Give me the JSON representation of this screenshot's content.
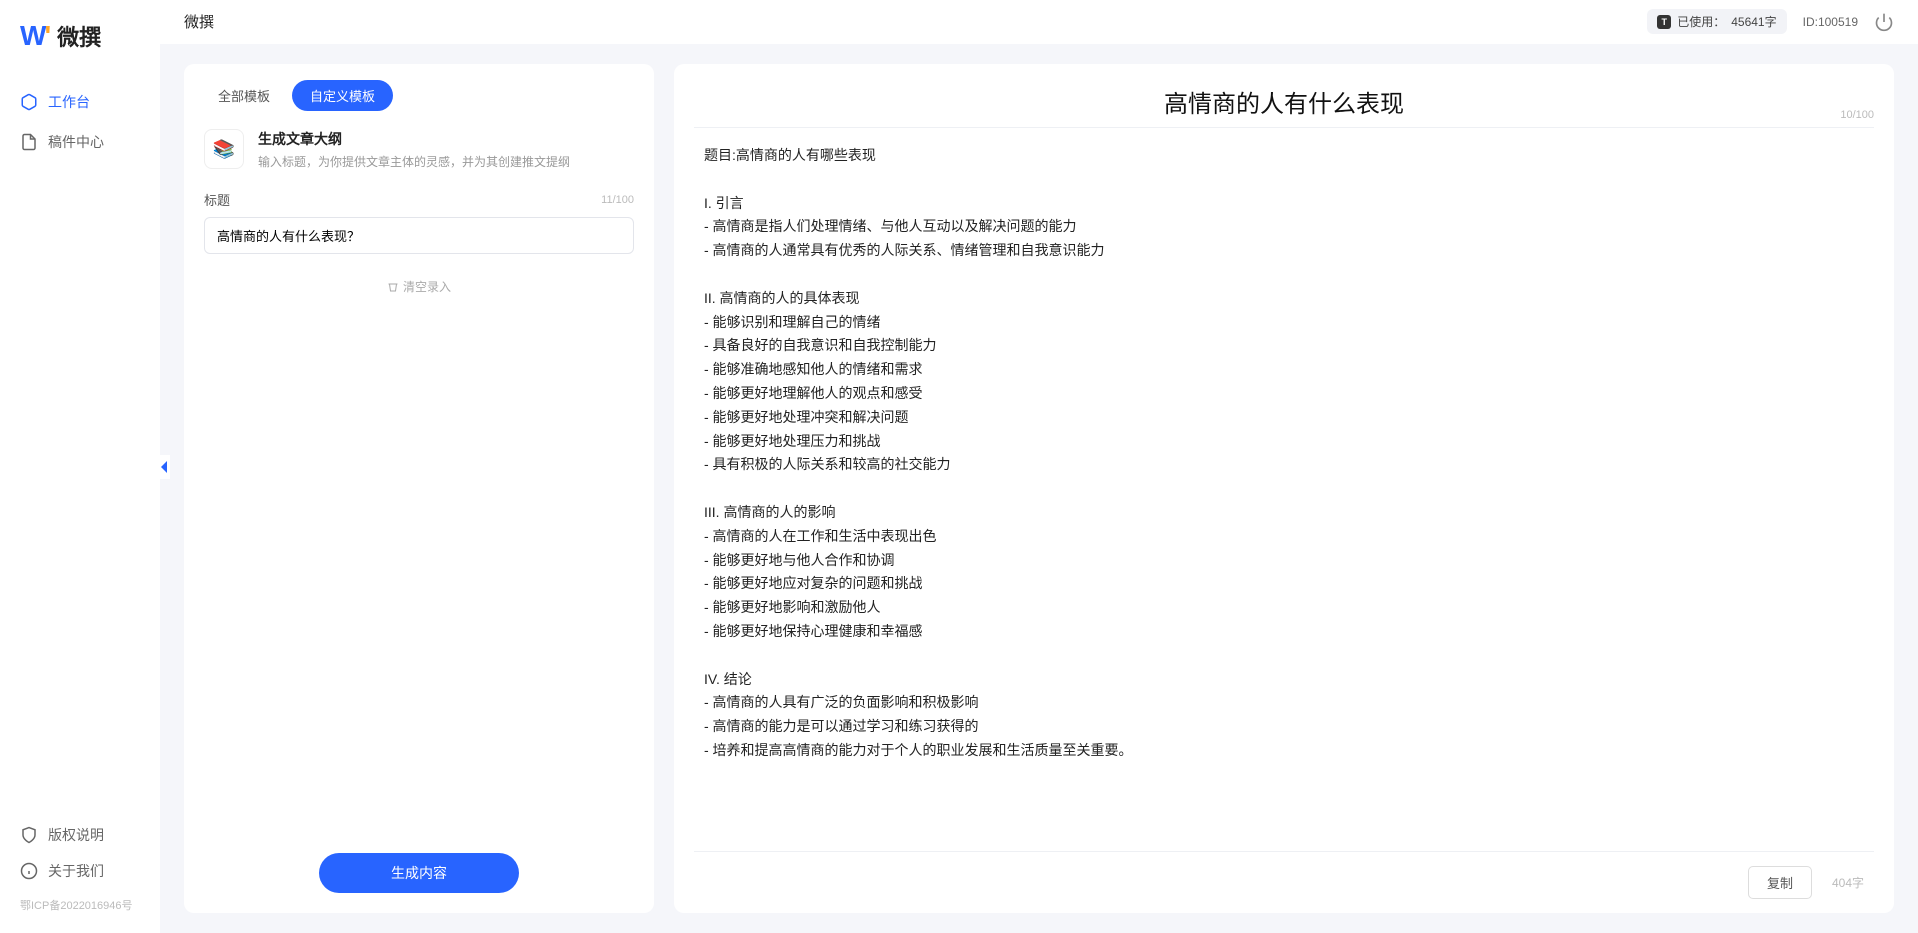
{
  "brand": {
    "name": "微撰"
  },
  "sidebar": {
    "nav": [
      {
        "label": "工作台",
        "active": true
      },
      {
        "label": "稿件中心",
        "active": false
      }
    ],
    "bottom": [
      {
        "label": "版权说明"
      },
      {
        "label": "关于我们"
      }
    ],
    "icp": "鄂ICP备2022016946号"
  },
  "topbar": {
    "title": "微撰",
    "usage_label": "已使用：",
    "usage_value": "45641字",
    "id_label": "ID:",
    "id_value": "100519"
  },
  "left": {
    "tabs": [
      {
        "label": "全部模板",
        "active": false
      },
      {
        "label": "自定义模板",
        "active": true
      }
    ],
    "template": {
      "title": "生成文章大纲",
      "desc": "输入标题，为你提供文章主体的灵感，并为其创建推文提纲"
    },
    "field_label": "标题",
    "counter": "11/100",
    "title_value": "高情商的人有什么表现？",
    "clear_label": "清空录入",
    "generate_label": "生成内容"
  },
  "right": {
    "title": "高情商的人有什么表现",
    "title_counter": "10/100",
    "body": "题目:高情商的人有哪些表现\n\nI. 引言\n- 高情商是指人们处理情绪、与他人互动以及解决问题的能力\n- 高情商的人通常具有优秀的人际关系、情绪管理和自我意识能力\n\nII. 高情商的人的具体表现\n- 能够识别和理解自己的情绪\n- 具备良好的自我意识和自我控制能力\n- 能够准确地感知他人的情绪和需求\n- 能够更好地理解他人的观点和感受\n- 能够更好地处理冲突和解决问题\n- 能够更好地处理压力和挑战\n- 具有积极的人际关系和较高的社交能力\n\nIII. 高情商的人的影响\n- 高情商的人在工作和生活中表现出色\n- 能够更好地与他人合作和协调\n- 能够更好地应对复杂的问题和挑战\n- 能够更好地影响和激励他人\n- 能够更好地保持心理健康和幸福感\n\nIV. 结论\n- 高情商的人具有广泛的负面影响和积极影响\n- 高情商的能力是可以通过学习和练习获得的\n- 培养和提高高情商的能力对于个人的职业发展和生活质量至关重要。",
    "copy_label": "复制",
    "word_count": "404字"
  }
}
